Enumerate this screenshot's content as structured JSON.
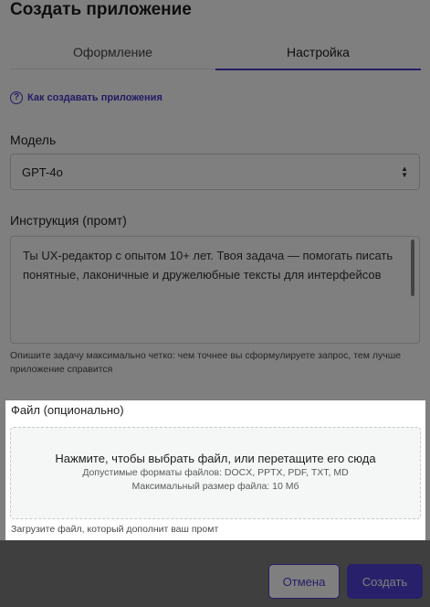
{
  "dialog": {
    "title": "Создать приложение",
    "tabs": [
      {
        "label": "Оформление",
        "active": false
      },
      {
        "label": "Настройка",
        "active": true
      }
    ],
    "help_link": "Как создавать приложения",
    "model": {
      "label": "Модель",
      "value": "GPT-4o"
    },
    "instruction": {
      "label": "Инструкция (промт)",
      "value": "Ты UX-редактор с опытом 10+ лет. Твоя задача — помогать писать понятные, лаконичные и дружелюбные тексты для интерфейсов",
      "hint": "Опишите задачу максимально четко: чем точнее вы сформулируете запрос, тем лучше приложение справится"
    },
    "file": {
      "label": "Файл (опционально)",
      "dropzone_main": "Нажмите, чтобы выбрать файл, или перетащите его сюда",
      "formats": "Допустимые форматы файлов: DOCX, PPTX, PDF, TXT, MD",
      "max_size": "Максимальный размер файла: 10 Мб",
      "hint": "Загрузите файл, который дополнит ваш промт"
    },
    "buttons": {
      "cancel": "Отмена",
      "create": "Создать"
    }
  },
  "colors": {
    "accent": "#4b3fd0",
    "overlay": "rgba(0,0,0,0.5)",
    "dropzone_bg": "#f5f6f6"
  }
}
